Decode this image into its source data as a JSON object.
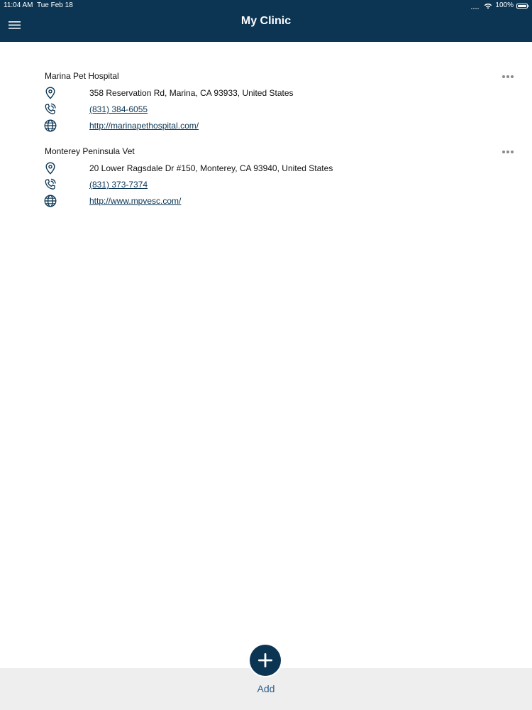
{
  "status_bar": {
    "time": "11:04 AM",
    "date": "Tue Feb 18",
    "battery": "100%",
    "icons": [
      "cellular-signal-icon",
      "wifi-icon",
      "battery-icon"
    ]
  },
  "header": {
    "title": "My Clinic",
    "menu_icon": "hamburger-menu-icon",
    "background_color": "#0b3553"
  },
  "clinics": [
    {
      "name": "Marina Pet Hospital",
      "address": "358 Reservation Rd, Marina, CA 93933, United States",
      "phone": "(831) 384-6055",
      "website": "http://marinapethospital.com/"
    },
    {
      "name": "Monterey Peninsula Vet",
      "address": "20 Lower Ragsdale Dr #150, Monterey, CA 93940, United States",
      "phone": "(831) 373-7374",
      "website": "http://www.mpvesc.com/"
    }
  ],
  "icons": {
    "address": "map-pin-icon",
    "phone": "phone-icon",
    "website": "globe-icon",
    "more": "more-options-icon",
    "add": "plus-icon"
  },
  "footer": {
    "add_label": "Add",
    "accent_color": "#0b3553"
  }
}
